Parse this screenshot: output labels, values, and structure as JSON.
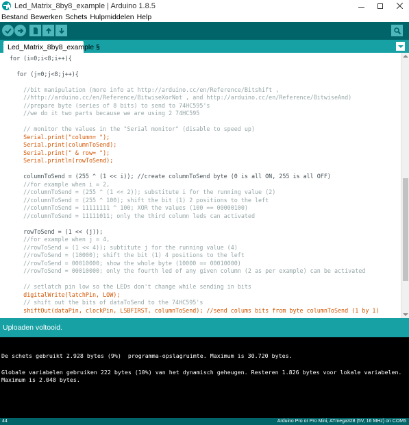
{
  "window": {
    "title": "Led_Matrix_8by8_example | Arduino 1.8.5",
    "app_icon": "arduino-logo-icon",
    "controls": [
      "minimize-icon",
      "maximize-icon",
      "close-icon"
    ]
  },
  "menu": {
    "items": [
      "Bestand",
      "Bewerken",
      "Schets",
      "Hulpmiddelen",
      "Help"
    ]
  },
  "toolbar": {
    "buttons": [
      {
        "name": "verify",
        "icon": "checkmark-icon"
      },
      {
        "name": "upload",
        "icon": "arrow-right-icon"
      },
      {
        "name": "new",
        "icon": "new-file-icon"
      },
      {
        "name": "open",
        "icon": "arrow-up-icon"
      },
      {
        "name": "save",
        "icon": "arrow-down-icon"
      },
      {
        "name": "serial-monitor",
        "icon": "magnifier-icon"
      }
    ]
  },
  "tabs": {
    "active_label": "Led_Matrix_8by8_example §",
    "menu_icon": "triangle-down-icon"
  },
  "editor": {
    "lines": [
      "for (i=0;i<8;i++){",
      "",
      "  for (j=0;j<8;j++){",
      "",
      "    //bit manipulation (more info at http://arduino.cc/en/Reference/Bitshift ,",
      "    //http://arduino.cc/en/Reference/BitwiseXorNot , and http://arduino.cc/en/Reference/BitwiseAnd)",
      "    //prepare byte (series of 8 bits) to send to 74HC595's",
      "    //we do it two parts because we are using 2 74HC595",
      "",
      "    // monitor the values in the \"Serial monitor\" (disable to speed up)",
      "    Serial.print(\"column= \");",
      "    Serial.print(columnToSend);",
      "    Serial.print(\" & row= \");",
      "    Serial.println(rowToSend);",
      "",
      "    columnToSend = (255 ^ (1 << i)); //create columnToSend byte (0 is all ON, 255 is all OFF)",
      "    //for example when i = 2,",
      "    //columnToSend = (255 ^ (1 << 2)); substitute i for the running value (2)",
      "    //columnToSend = (255 ^ 100); shift the bit (1) 2 positions to the left",
      "    //columnToSend = 11111111 ^ 100; XOR the values (100 == 00000100)",
      "    //columnToSend = 11111011; only the third column leds can activated",
      "",
      "    rowToSend = (1 << (j));",
      "    //for example when j = 4,",
      "    //rowToSend = (1 << 4)); subtitute j for the running value (4)",
      "    //rowToSend = (10000); shift the bit (1) 4 positions to the left",
      "    //rowToSend = 00010000; show the whole byte (10000 == 00010000)",
      "    //rowToSend = 00010000; only the fourth led of any given column (2 as per example) can be activated",
      "",
      "    // setlatch pin low so the LEDs don't change while sending in bits",
      "    digitalWrite(latchPin, LOW);",
      "    // shift out the bits of dataToSend to the 74HC595's",
      "    shiftOut(dataPin, clockPin, LSBFIRST, columnToSend); //send colums bits from byte columnToSend (1 by 1)"
    ]
  },
  "status": {
    "message": "Uploaden voltooid."
  },
  "console": {
    "lines": [
      "De schets gebruikt 2.928 bytes (9%)  programma-opslagruimte. Maximum is 30.720 bytes.",
      "Globale variabelen gebruiken 222 bytes (10%) van het dynamisch geheugen. Resteren 1.826 bytes voor lokale variabelen.",
      "Maximum is 2.048 bytes."
    ]
  },
  "footer": {
    "line_number": "44",
    "board": "Arduino Pro or Pro Mini, ATmega328 (5V, 16 MHz) on COM5"
  },
  "colors": {
    "toolbar": "#006468",
    "tabbar": "#17a1a5",
    "button": "#4db7bb",
    "keyword": "#d35400",
    "constant": "#00979c",
    "comment": "#95a5a6",
    "console_bg": "#000000"
  }
}
